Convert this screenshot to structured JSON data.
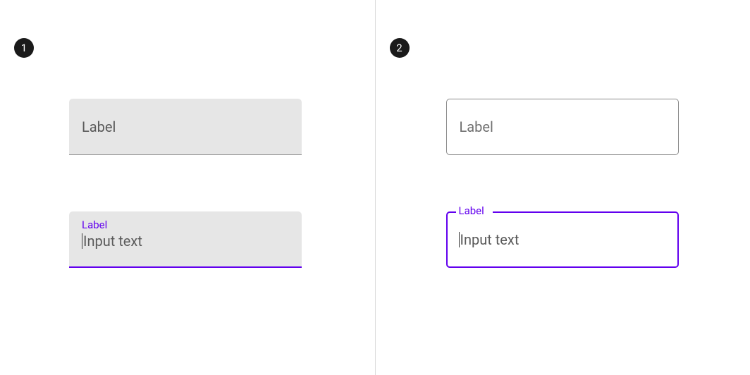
{
  "panels": {
    "left": {
      "badge": "1",
      "filled_inactive": {
        "label": "Label"
      },
      "filled_active": {
        "label": "Label",
        "input_text": "Input text"
      }
    },
    "right": {
      "badge": "2",
      "outlined_inactive": {
        "label": "Label"
      },
      "outlined_active": {
        "label": "Label",
        "input_text": "Input text"
      }
    }
  },
  "colors": {
    "accent": "#6200ee",
    "filled_bg": "#e6e6e6",
    "text_muted": "#5a5a5a"
  }
}
